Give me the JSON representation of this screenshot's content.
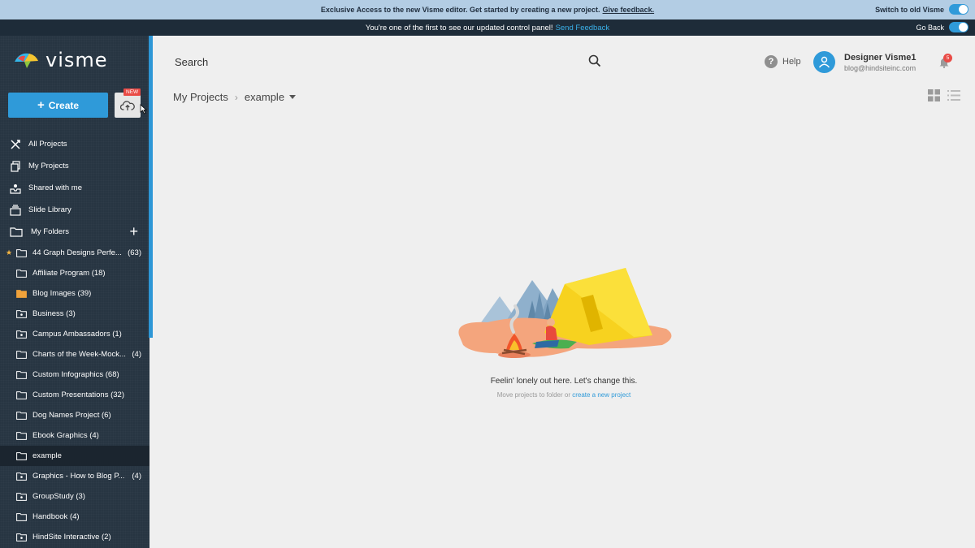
{
  "banner_top": {
    "message": "Exclusive Access to the new Visme editor. Get started by creating a new project.",
    "link": "Give feedback.",
    "toggle_label": "Switch to old Visme"
  },
  "banner_second": {
    "message": "You're one of the first to see our updated control panel!",
    "link": "Send Feedback",
    "toggle_label": "Go Back"
  },
  "logo": {
    "text": "visme"
  },
  "create_button": {
    "label": "Create"
  },
  "upload_badge": "NEW",
  "nav": {
    "all_projects": "All Projects",
    "my_projects": "My Projects",
    "shared": "Shared with me",
    "slide_library": "Slide Library",
    "my_folders": "My Folders"
  },
  "folders": [
    {
      "name": "44 Graph Designs Perfe...",
      "count": "(63)",
      "starred": true
    },
    {
      "name": "Affiliate Program (18)",
      "count": ""
    },
    {
      "name": "Blog Images (39)",
      "count": ""
    },
    {
      "name": "Business (3)",
      "count": ""
    },
    {
      "name": "Campus Ambassadors (1)",
      "count": ""
    },
    {
      "name": "Charts of the Week-Mock...",
      "count": "(4)"
    },
    {
      "name": "Custom Infographics (68)",
      "count": ""
    },
    {
      "name": "Custom Presentations (32)",
      "count": ""
    },
    {
      "name": "Dog Names Project (6)",
      "count": ""
    },
    {
      "name": "Ebook Graphics (4)",
      "count": ""
    },
    {
      "name": "example",
      "count": ""
    },
    {
      "name": "Graphics - How to Blog P...",
      "count": "(4)"
    },
    {
      "name": "GroupStudy (3)",
      "count": ""
    },
    {
      "name": "Handbook (4)",
      "count": ""
    },
    {
      "name": "HindSite Interactive (2)",
      "count": ""
    }
  ],
  "header": {
    "search_label": "Search",
    "help_label": "Help",
    "user_name": "Designer Visme1",
    "user_email": "blog@hindsiteinc.com",
    "notification_count": "5"
  },
  "breadcrumb": {
    "root": "My Projects",
    "current": "example"
  },
  "empty_state": {
    "title": "Feelin' lonely out here. Let's change this.",
    "subtitle_prefix": "Move projects to folder or",
    "subtitle_link": "create a new project"
  },
  "colors": {
    "accent": "#2f9ad9",
    "sidebar": "#273542",
    "badge": "#e94b46"
  }
}
